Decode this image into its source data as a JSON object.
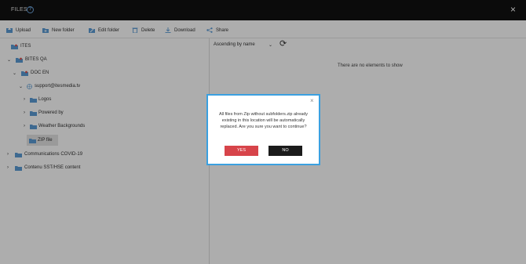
{
  "header": {
    "title": "FILES",
    "help_icon": "?",
    "close_icon": "×"
  },
  "toolbar": {
    "upload": "Upload",
    "new_folder": "New folder",
    "edit_folder": "Edit folder",
    "delete": "Delete",
    "download": "Download",
    "share": "Share"
  },
  "tree": {
    "items": [
      {
        "label": "ITES"
      },
      {
        "arrow": "⌄",
        "label": "BITES QA"
      },
      {
        "arrow": "⌄",
        "label": "DOC EN"
      },
      {
        "arrow": "⌄",
        "label": "support@itesmedia.tv"
      },
      {
        "arrow": "›",
        "label": "Logos"
      },
      {
        "arrow": "›",
        "label": "Powered by"
      },
      {
        "arrow": "›",
        "label": "Weather Backgrounds"
      },
      {
        "label": "ZIP file"
      },
      {
        "arrow": "›",
        "label": "Communications COVID-19"
      },
      {
        "arrow": "›",
        "label": "Contenu SST/HSE content"
      }
    ]
  },
  "content": {
    "sort_label": "Ascending by name",
    "sort_caret": "⌄",
    "refresh_icon": "⟳",
    "empty_message": "There are no elements to show"
  },
  "modal": {
    "close": "×",
    "message": "All files from Zip without subfolders.zip already existing in this location will be automatically replaced. Are you sure you want to continue?",
    "yes": "YES",
    "no": "NO"
  },
  "colors": {
    "accent": "#3aa0e0",
    "danger": "#d7444a",
    "folder": "#5b9bd5"
  }
}
